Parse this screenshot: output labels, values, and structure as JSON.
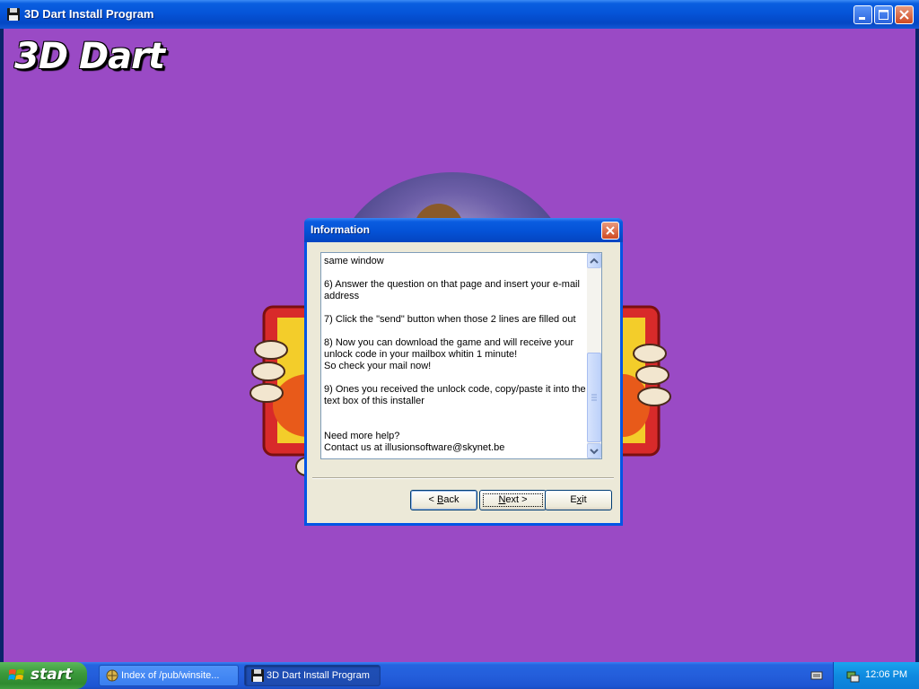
{
  "window": {
    "title": "3D Dart Install Program",
    "heading": "3D Dart"
  },
  "dialog": {
    "title": "Information",
    "text": "same window\n\n6) Answer the question on that page and insert your e-mail\naddress\n\n7) Click the \"send\" button when those 2 lines are filled out\n\n8) Now you can download the game and will receive your\nunlock code in your mailbox whitin 1 minute!\nSo check your mail now!\n\n9) Ones you received the unlock code, copy/paste it into the\ntext box of this installer\n\n\nNeed more help?\nContact us at illusionsoftware@skynet.be",
    "buttons": {
      "back": {
        "prefix": "< ",
        "mnemonic": "B",
        "rest": "ack"
      },
      "next": {
        "mnemonic": "N",
        "rest": "ext >"
      },
      "exit": {
        "prefix": "E",
        "mnemonic": "x",
        "rest": "it"
      }
    }
  },
  "taskbar": {
    "start_label": "start",
    "tasks": [
      {
        "label": "Index of /pub/winsite...",
        "icon": "browser-icon"
      },
      {
        "label": "3D Dart Install Program",
        "icon": "installer-icon"
      }
    ],
    "clock": "12:06 PM"
  },
  "colors": {
    "desktop_purple": "#9a4ac5",
    "xp_blue": "#0554d8",
    "dialog_face": "#ece9d8"
  }
}
